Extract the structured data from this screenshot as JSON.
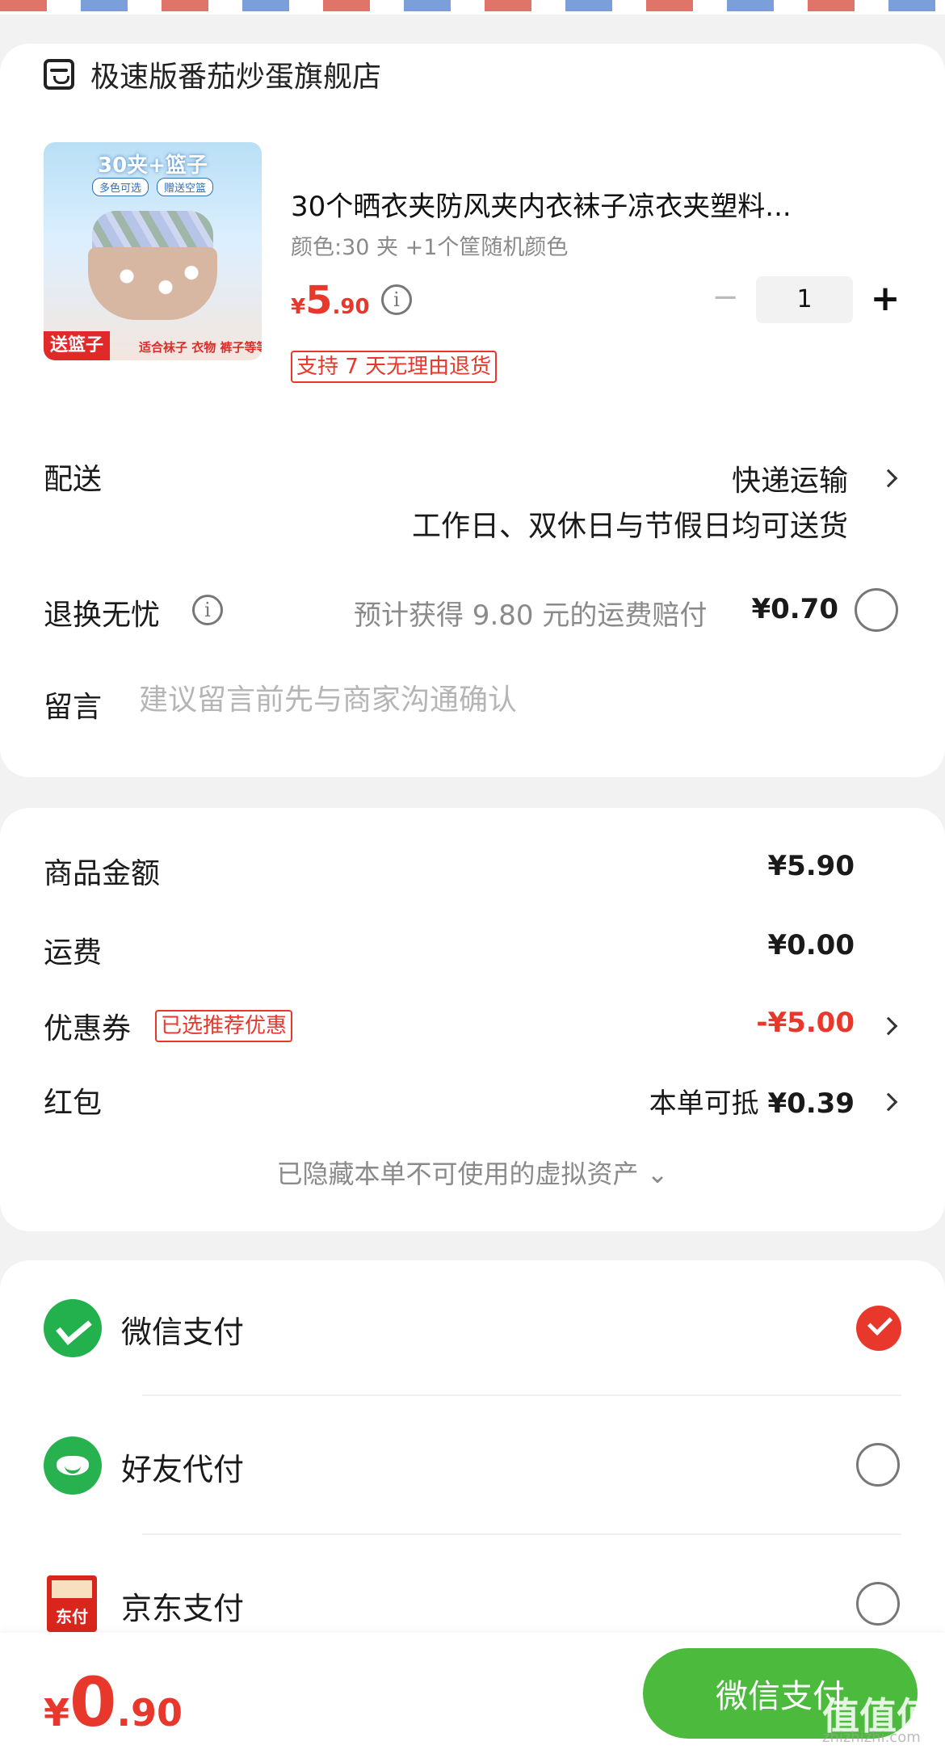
{
  "shop": {
    "name": "极速版番茄炒蛋旗舰店",
    "icon": "shop-icon"
  },
  "product": {
    "image_text": {
      "top": "30夹+篮子",
      "tag1": "多色可选",
      "tag2": "赠送空篮",
      "send": "送篮子",
      "fit": "适合袜子 衣物 裤子等等"
    },
    "title": "30个晒衣夹防风夹内衣袜子凉衣夹塑料...",
    "spec": "颜色:30 夹 +1个筐随机颜色",
    "price": {
      "currency": "¥",
      "integer": "5",
      "decimal": ".90"
    },
    "quantity": "1",
    "minus": "−",
    "plus": "+",
    "return_tag": "支持 7 天无理由退货"
  },
  "delivery": {
    "label": "配送",
    "method": "快递运输",
    "note": "工作日、双休日与节假日均可送货"
  },
  "return_worry": {
    "label": "退换无忧",
    "text": "预计获得 9.80 元的运费赔付",
    "price": "¥0.70",
    "info_glyph": "i"
  },
  "message": {
    "label": "留言",
    "placeholder": "建议留言前先与商家沟通确认"
  },
  "summary": {
    "goods_label": "商品金额",
    "goods_value": "¥5.90",
    "shipping_label": "运费",
    "shipping_value": "¥0.00",
    "coupon_label": "优惠券",
    "coupon_tag": "已选推荐优惠",
    "coupon_value": "-¥5.00",
    "red_label": "红包",
    "red_prefix": "本单可抵",
    "red_value": "¥0.39",
    "hidden_assets": "已隐藏本单不可使用的虚拟资产 ⌄"
  },
  "payment": {
    "methods": [
      {
        "label": "微信支付",
        "icon": "wechat-pay-icon",
        "selected": true
      },
      {
        "label": "好友代付",
        "icon": "friend-pay-icon",
        "selected": false
      },
      {
        "label": "京东支付",
        "icon": "jd-pay-icon",
        "icon_text": "东付",
        "selected": false
      }
    ]
  },
  "footer": {
    "total": {
      "currency": "¥",
      "integer": "0",
      "decimal": ".90"
    },
    "pay_button": "微信支付",
    "watermark": "值值值",
    "watermark_sub": "zhizhizhi.com"
  },
  "colors": {
    "accent_red": "#e8372b",
    "wechat_green": "#4cba3c"
  }
}
